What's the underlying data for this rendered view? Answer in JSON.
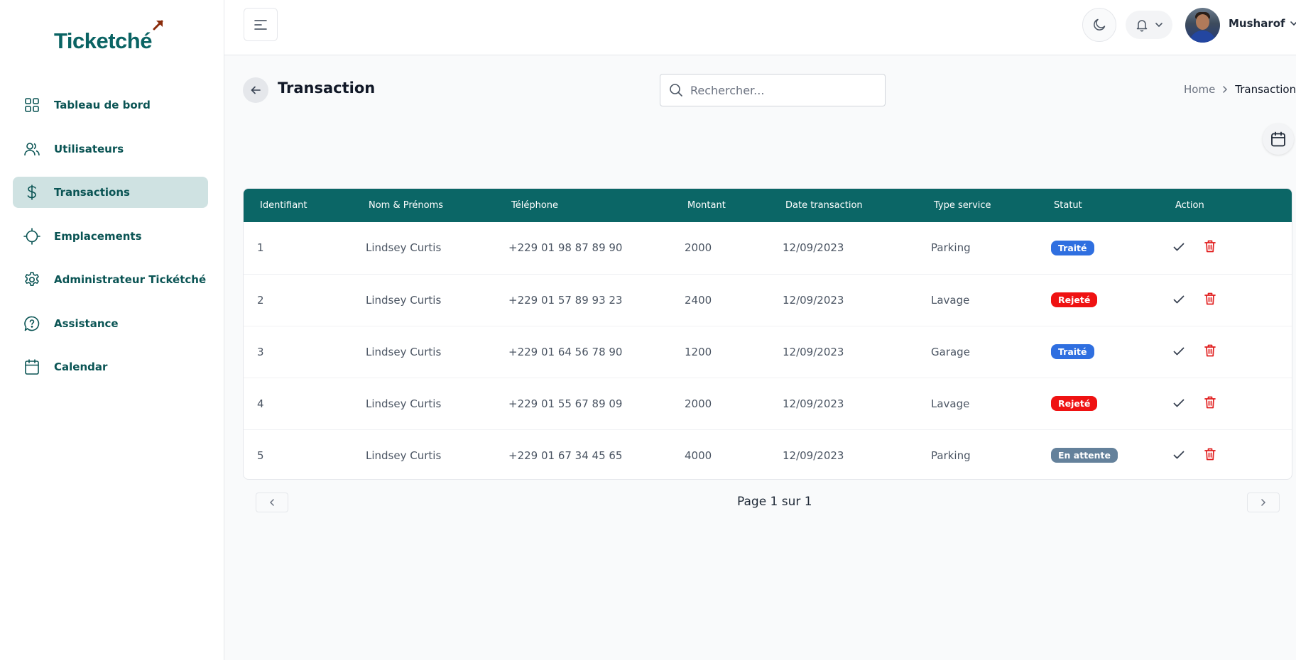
{
  "brand": {
    "name": "Ticketché",
    "accent": "#0b6666",
    "arrow_color": "#8a2b0a"
  },
  "sidebar": {
    "items": [
      {
        "label": "Tableau de bord",
        "icon": "grid-icon",
        "active": false
      },
      {
        "label": "Utilisateurs",
        "icon": "users-icon",
        "active": false
      },
      {
        "label": "Transactions",
        "icon": "dollar-icon",
        "active": true
      },
      {
        "label": "Emplacements",
        "icon": "crosshair-icon",
        "active": false
      },
      {
        "label": "Administrateur Tickétché",
        "icon": "gear-icon",
        "active": false
      },
      {
        "label": "Assistance",
        "icon": "help-chat-icon",
        "active": false
      },
      {
        "label": "Calendar",
        "icon": "calendar-icon",
        "active": false
      }
    ]
  },
  "header": {
    "user_name": "Musharof"
  },
  "page": {
    "title": "Transaction",
    "search_placeholder": "Rechercher...",
    "breadcrumb": {
      "home": "Home",
      "current": "Transaction"
    }
  },
  "table": {
    "columns": [
      "Identifiant",
      "Nom & Prénoms",
      "Téléphone",
      "Montant",
      "Date transaction",
      "Type service",
      "Statut",
      "Action"
    ],
    "rows": [
      {
        "id": "1",
        "name": "Lindsey Curtis",
        "phone": "+229 01 98 87 89 90",
        "amount": "2000",
        "date": "12/09/2023",
        "service": "Parking",
        "status": "Traité",
        "status_color": "#2f6fe0"
      },
      {
        "id": "2",
        "name": "Lindsey Curtis",
        "phone": "+229 01 57 89 93 23",
        "amount": "2400",
        "date": "12/09/2023",
        "service": "Lavage",
        "status": "Rejeté",
        "status_color": "#ef1212"
      },
      {
        "id": "3",
        "name": "Lindsey Curtis",
        "phone": "+229 01 64 56 78 90",
        "amount": "1200",
        "date": "12/09/2023",
        "service": "Garage",
        "status": "Traité",
        "status_color": "#2f6fe0"
      },
      {
        "id": "4",
        "name": "Lindsey Curtis",
        "phone": "+229 01 55 67 89 09",
        "amount": "2000",
        "date": "12/09/2023",
        "service": "Lavage",
        "status": "Rejeté",
        "status_color": "#ef1212"
      },
      {
        "id": "5",
        "name": "Lindsey Curtis",
        "phone": "+229 01 67 34 45 65",
        "amount": "4000",
        "date": "12/09/2023",
        "service": "Parking",
        "status": "En attente",
        "status_color": "#64819b"
      }
    ]
  },
  "pagination": {
    "info": "Page 1 sur 1"
  }
}
